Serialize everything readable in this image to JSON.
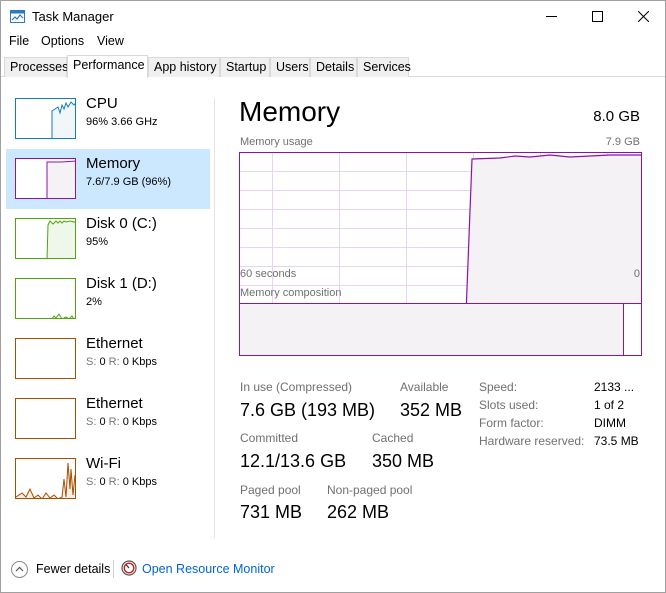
{
  "window": {
    "title": "Task Manager"
  },
  "menu": [
    "File",
    "Options",
    "View"
  ],
  "tabs": [
    "Processes",
    "Performance",
    "App history",
    "Startup",
    "Users",
    "Details",
    "Services"
  ],
  "sidebar": [
    {
      "title": "CPU",
      "sub": "96%  3.66 GHz",
      "color": "#117dbb"
    },
    {
      "title": "Memory",
      "sub": "7.6/7.9 GB (96%)",
      "color": "#8b12ae"
    },
    {
      "title": "Disk 0 (C:)",
      "sub": "95%",
      "color": "#4da60c"
    },
    {
      "title": "Disk 1 (D:)",
      "sub": "2%",
      "color": "#4da60c"
    },
    {
      "title": "Ethernet",
      "sub_s": "S: ",
      "sub_s_val": "0",
      "sub_r": " R: ",
      "sub_r_val": "0 Kbps",
      "color": "#a74f01"
    },
    {
      "title": "Ethernet",
      "sub_s": "S: ",
      "sub_s_val": "0",
      "sub_r": " R: ",
      "sub_r_val": "0 Kbps",
      "color": "#a74f01"
    },
    {
      "title": "Wi-Fi",
      "sub_s": "S: ",
      "sub_s_val": "0",
      "sub_r": " R: ",
      "sub_r_val": "0 Kbps",
      "color": "#a74f01"
    }
  ],
  "main": {
    "title": "Memory",
    "total": "8.0 GB",
    "usage_label": "Memory usage",
    "usage_max": "7.9 GB",
    "time_left": "60 seconds",
    "time_right": "0",
    "composition_label": "Memory composition",
    "stats": {
      "in_use_label": "In use (Compressed)",
      "in_use_val": "7.6 GB (193 MB)",
      "available_label": "Available",
      "available_val": "352 MB",
      "committed_label": "Committed",
      "committed_val": "12.1/13.6 GB",
      "cached_label": "Cached",
      "cached_val": "350 MB",
      "paged_label": "Paged pool",
      "paged_val": "731 MB",
      "nonpaged_label": "Non-paged pool",
      "nonpaged_val": "262 MB"
    },
    "specs": {
      "speed_label": "Speed:",
      "speed_val": "2133 ...",
      "slots_label": "Slots used:",
      "slots_val": "1 of 2",
      "form_label": "Form factor:",
      "form_val": "DIMM",
      "reserved_label": "Hardware reserved:",
      "reserved_val": "73.5 MB"
    }
  },
  "footer": {
    "fewer": "Fewer details",
    "monitor": "Open Resource Monitor"
  },
  "colors": {
    "memory": "#8b12ae",
    "cpu": "#117dbb",
    "disk": "#4da60c",
    "net": "#a74f01",
    "selected": "#cce8ff",
    "link": "#0066cc"
  }
}
